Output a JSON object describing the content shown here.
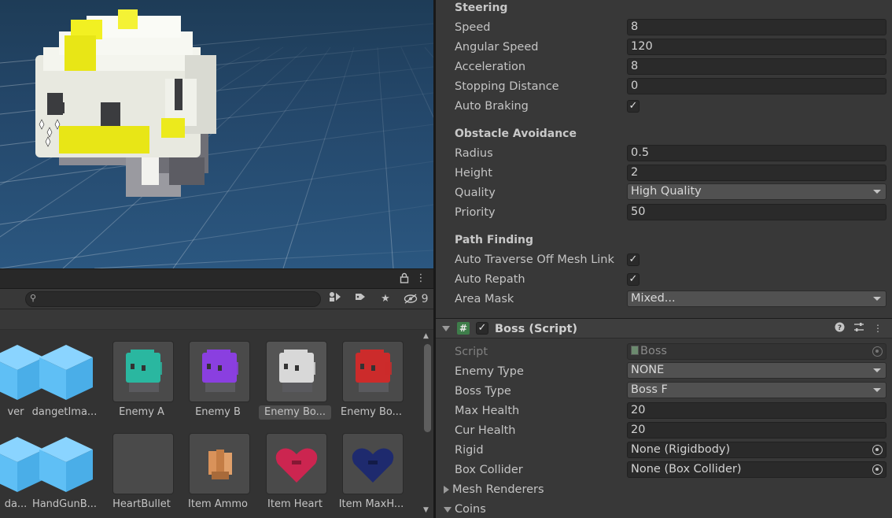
{
  "scene": {
    "description_icon": "scene-gizmo-icon"
  },
  "project": {
    "header_icons": [
      "lock-icon",
      "kebab-menu-icon"
    ],
    "search": {
      "value": "",
      "placeholder": ""
    },
    "toolbar": {
      "hidden_count": "9"
    },
    "assets": [
      {
        "label": "ver",
        "kind": "partial-cube"
      },
      {
        "label": "dangetIma...",
        "kind": "cube"
      },
      {
        "label": "Enemy A",
        "kind": "enemy",
        "color": "#2ab7a0"
      },
      {
        "label": "Enemy B",
        "kind": "enemy",
        "color": "#8a3fe0"
      },
      {
        "label": "Enemy Bo...",
        "kind": "enemy",
        "color": "#d8d8d8",
        "selected": true
      },
      {
        "label": "Enemy Bo...",
        "kind": "enemy",
        "color": "#cc2b2b"
      },
      {
        "label": "da...",
        "kind": "partial-cube"
      },
      {
        "label": "HandGunB...",
        "kind": "cube"
      },
      {
        "label": "HeartBullet",
        "kind": "empty"
      },
      {
        "label": "Item Ammo",
        "kind": "ammo"
      },
      {
        "label": "Item Heart",
        "kind": "heart",
        "color": "#cc2550"
      },
      {
        "label": "Item MaxH...",
        "kind": "heart",
        "color": "#1e2a6e"
      }
    ]
  },
  "inspector": {
    "steering": {
      "title": "Steering",
      "speed": {
        "label": "Speed",
        "value": "8"
      },
      "angular_speed": {
        "label": "Angular Speed",
        "value": "120"
      },
      "acceleration": {
        "label": "Acceleration",
        "value": "8"
      },
      "stopping_distance": {
        "label": "Stopping Distance",
        "value": "0"
      },
      "auto_braking": {
        "label": "Auto Braking",
        "checked": true
      }
    },
    "obstacle": {
      "title": "Obstacle Avoidance",
      "radius": {
        "label": "Radius",
        "value": "0.5"
      },
      "height": {
        "label": "Height",
        "value": "2"
      },
      "quality": {
        "label": "Quality",
        "value": "High Quality"
      },
      "priority": {
        "label": "Priority",
        "value": "50"
      }
    },
    "path": {
      "title": "Path Finding",
      "auto_traverse": {
        "label": "Auto Traverse Off Mesh Link",
        "checked": true
      },
      "auto_repath": {
        "label": "Auto Repath",
        "checked": true
      },
      "area_mask": {
        "label": "Area Mask",
        "value": "Mixed..."
      }
    },
    "component": {
      "title": "Boss (Script)",
      "enabled": true,
      "script": {
        "label": "Script",
        "value": "Boss"
      },
      "enemy_type": {
        "label": "Enemy Type",
        "value": "NONE"
      },
      "boss_type": {
        "label": "Boss Type",
        "value": "Boss F"
      },
      "max_health": {
        "label": "Max Health",
        "value": "20"
      },
      "cur_health": {
        "label": "Cur Health",
        "value": "20"
      },
      "rigid": {
        "label": "Rigid",
        "value": "None (Rigidbody)"
      },
      "box_collider": {
        "label": "Box Collider",
        "value": "None (Box Collider)"
      },
      "mesh_renderers": {
        "label": "Mesh Renderers"
      },
      "coins": {
        "label": "Coins"
      }
    },
    "checkmark": "✓",
    "colors": {
      "accent": "#3e7d4a",
      "field_bg": "#2a2a2a",
      "panel_bg": "#383838"
    }
  }
}
